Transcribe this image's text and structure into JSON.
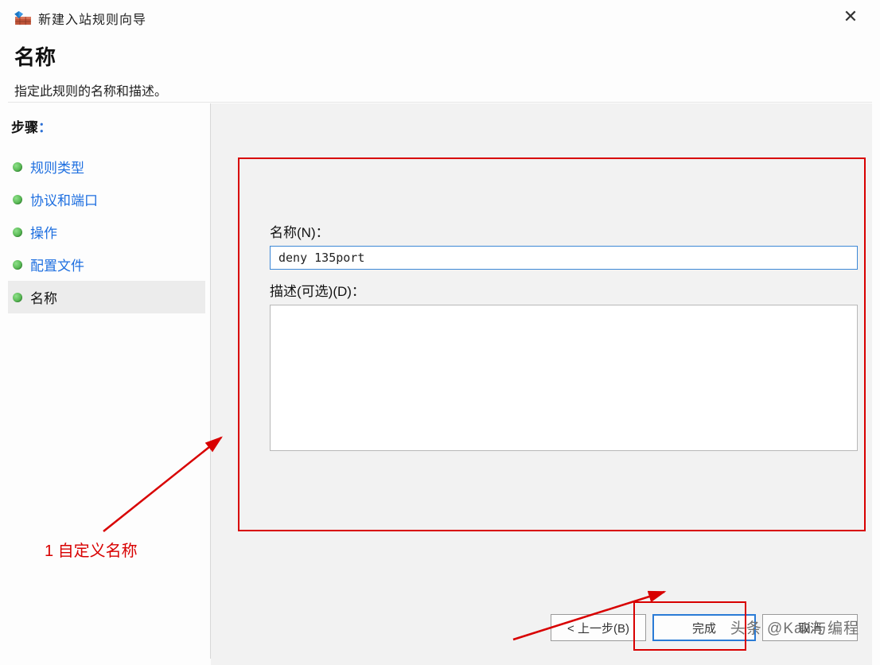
{
  "window": {
    "title": "新建入站规则向导"
  },
  "header": {
    "title": "名称",
    "subtitle": "指定此规则的名称和描述。"
  },
  "sidebar": {
    "steps_label": "步骤",
    "colon": "：",
    "items": [
      {
        "label": "规则类型"
      },
      {
        "label": "协议和端口"
      },
      {
        "label": "操作"
      },
      {
        "label": "配置文件"
      },
      {
        "label": "名称"
      }
    ]
  },
  "form": {
    "name_label": "名称(N)：",
    "name_value": "deny 135port",
    "desc_label": "描述(可选)(D)：",
    "desc_value": ""
  },
  "buttons": {
    "back": "< 上一步(B)",
    "finish": "完成",
    "cancel": "取消"
  },
  "annotations": {
    "a1": "1 自定义名称"
  },
  "watermark": "头条 @Kali与编程"
}
